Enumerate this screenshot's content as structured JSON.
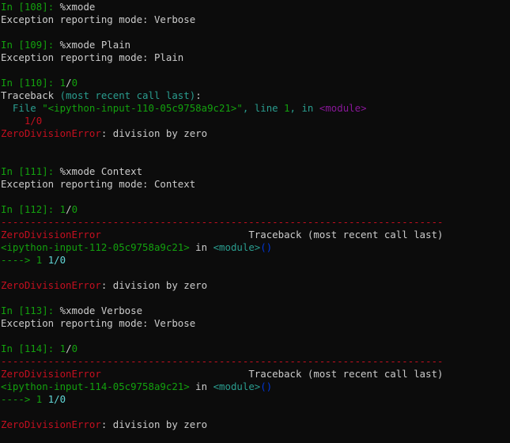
{
  "colors": {
    "background": "#0c0c0c",
    "text": "#cccccc",
    "prompt": "#13a10e",
    "teal": "#2a9d8f",
    "error": "#c50f1f",
    "module": "#881798",
    "code": "#61d6d6",
    "paren": "#0037da"
  },
  "lines": [
    [
      [
        "green",
        "In ["
      ],
      [
        "green",
        "108"
      ],
      [
        "green",
        "]: "
      ],
      [
        "default",
        "%xmode"
      ]
    ],
    [
      [
        "default",
        "Exception reporting mode: Verbose"
      ]
    ],
    [],
    [
      [
        "green",
        "In ["
      ],
      [
        "green",
        "109"
      ],
      [
        "green",
        "]: "
      ],
      [
        "default",
        "%xmode Plain"
      ]
    ],
    [
      [
        "default",
        "Exception reporting mode: Plain"
      ]
    ],
    [],
    [
      [
        "green",
        "In ["
      ],
      [
        "green",
        "110"
      ],
      [
        "green",
        "]: "
      ],
      [
        "green",
        "1"
      ],
      [
        "default",
        "/"
      ],
      [
        "green",
        "0"
      ]
    ],
    [
      [
        "default",
        "Traceback "
      ],
      [
        "teal",
        "(most recent call last)"
      ],
      [
        "default",
        ":"
      ]
    ],
    [
      [
        "teal",
        "  File "
      ],
      [
        "green",
        "\"<ipython-input-110-05c9758a9c21>\""
      ],
      [
        "teal",
        ", line "
      ],
      [
        "green",
        "1"
      ],
      [
        "teal",
        ", in "
      ],
      [
        "magenta",
        "<module>"
      ]
    ],
    [
      [
        "red",
        "    1/0"
      ]
    ],
    [
      [
        "red",
        "ZeroDivisionError"
      ],
      [
        "default",
        ": division by zero"
      ]
    ],
    [],
    [],
    [
      [
        "green",
        "In ["
      ],
      [
        "green",
        "111"
      ],
      [
        "green",
        "]: "
      ],
      [
        "default",
        "%xmode Context"
      ]
    ],
    [
      [
        "default",
        "Exception reporting mode: Context"
      ]
    ],
    [],
    [
      [
        "green",
        "In ["
      ],
      [
        "green",
        "112"
      ],
      [
        "green",
        "]: "
      ],
      [
        "green",
        "1"
      ],
      [
        "default",
        "/"
      ],
      [
        "green",
        "0"
      ]
    ],
    [
      [
        "red",
        "---------------------------------------------------------------------------"
      ]
    ],
    [
      [
        "red",
        "ZeroDivisionError"
      ],
      [
        "default",
        "                         Traceback (most recent call last)"
      ]
    ],
    [
      [
        "green",
        "<ipython-input-112-05c9758a9c21>"
      ],
      [
        "default",
        " in "
      ],
      [
        "teal",
        "<module>"
      ],
      [
        "blue",
        "()"
      ]
    ],
    [
      [
        "green",
        "----> 1 "
      ],
      [
        "cyan",
        "1/0"
      ]
    ],
    [],
    [
      [
        "red",
        "ZeroDivisionError"
      ],
      [
        "default",
        ": division by zero"
      ]
    ],
    [],
    [
      [
        "green",
        "In ["
      ],
      [
        "green",
        "113"
      ],
      [
        "green",
        "]: "
      ],
      [
        "default",
        "%xmode Verbose"
      ]
    ],
    [
      [
        "default",
        "Exception reporting mode: Verbose"
      ]
    ],
    [],
    [
      [
        "green",
        "In ["
      ],
      [
        "green",
        "114"
      ],
      [
        "green",
        "]: "
      ],
      [
        "green",
        "1"
      ],
      [
        "default",
        "/"
      ],
      [
        "green",
        "0"
      ]
    ],
    [
      [
        "red",
        "---------------------------------------------------------------------------"
      ]
    ],
    [
      [
        "red",
        "ZeroDivisionError"
      ],
      [
        "default",
        "                         Traceback (most recent call last)"
      ]
    ],
    [
      [
        "green",
        "<ipython-input-114-05c9758a9c21>"
      ],
      [
        "default",
        " in "
      ],
      [
        "teal",
        "<module>"
      ],
      [
        "blue",
        "()"
      ]
    ],
    [
      [
        "green",
        "----> 1 "
      ],
      [
        "cyan",
        "1/0"
      ]
    ],
    [],
    [
      [
        "red",
        "ZeroDivisionError"
      ],
      [
        "default",
        ": division by zero"
      ]
    ]
  ]
}
